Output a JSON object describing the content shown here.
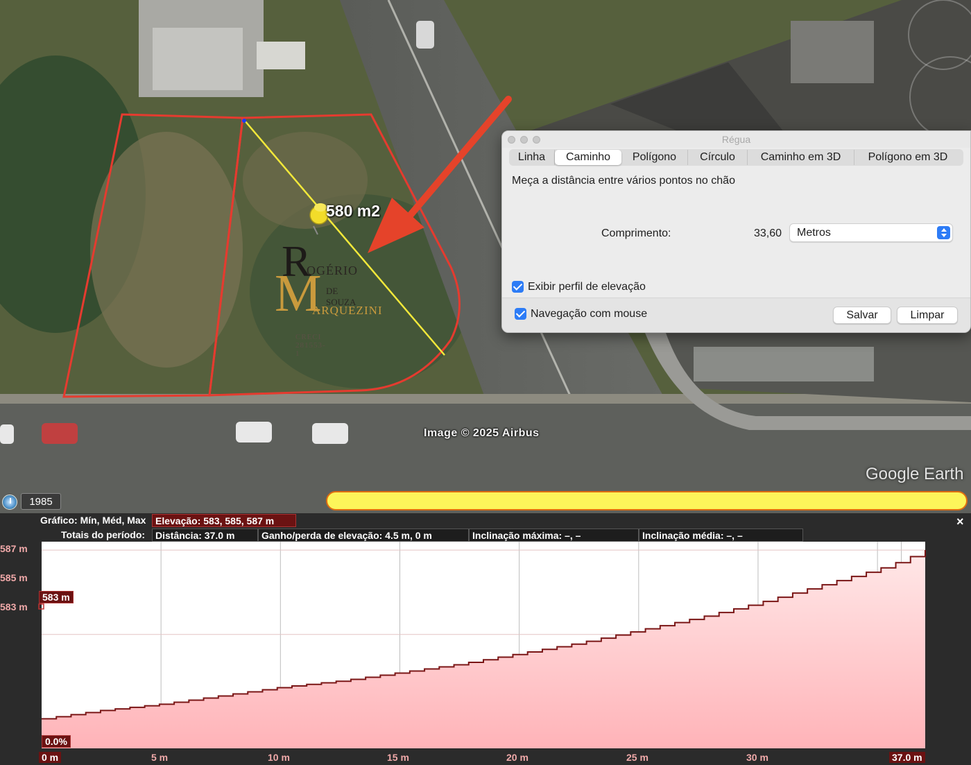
{
  "map": {
    "area_label": "580 m2",
    "attribution": "Image © 2025 Airbus",
    "brand": "Google Earth",
    "year": "1985",
    "watermark": {
      "r": "R",
      "ogerio": "OGÉRIO",
      "desouza": "DE SOUZA",
      "m": "M",
      "arquezini": "ARQUEZINI",
      "creci": "CRECI 281553-1"
    },
    "colors": {
      "parcel_outline": "#e53b2f",
      "measure_line": "#f2e83a",
      "arrow": "#e5432a",
      "timeline": "#fdf55a"
    },
    "icons": {
      "pin": "pushpin-icon",
      "clock": "historical-imagery-icon"
    }
  },
  "ruler": {
    "title": "Régua",
    "tabs": [
      "Linha",
      "Caminho",
      "Polígono",
      "Círculo",
      "Caminho em 3D",
      "Polígono em 3D"
    ],
    "active_tab": "Caminho",
    "description": "Meça a distância entre vários pontos no chão",
    "length_label": "Comprimento:",
    "length_value": "33,60",
    "unit": "Metros",
    "show_elevation_label": "Exibir perfil de elevação",
    "mouse_nav_label": "Navegação com mouse",
    "save_label": "Salvar",
    "clear_label": "Limpar",
    "accent": "#2d7cf6"
  },
  "profile": {
    "row1_label": "Gráfico: Mín, Méd, Max",
    "elevation": "Elevação: 583, 585, 587 m",
    "row2_label": "Totais do período:",
    "distance": "Distância: 37.0 m",
    "gain_loss": "Ganho/perda de elevação: 4.5 m, 0 m",
    "max_slope": "Inclinação máxima: –, –",
    "avg_slope": "Inclinação média: –, –",
    "close": "×",
    "y_ticks": [
      "587 m",
      "585 m",
      "583 m"
    ],
    "x_ticks": [
      "0 m",
      "5 m",
      "10 m",
      "15 m",
      "20 m",
      "25 m",
      "30 m",
      "37.0 m"
    ],
    "start_marker": "583 m",
    "slope_marker": "0.0%"
  },
  "chart_data": {
    "type": "line",
    "xlabel": "",
    "ylabel": "",
    "xlim": [
      0,
      37
    ],
    "ylim": [
      582.3,
      587.2
    ],
    "x": [
      0,
      2.5,
      5,
      7.5,
      10,
      12.5,
      15,
      17.5,
      20,
      22.5,
      25,
      27.5,
      30,
      32.5,
      35,
      36,
      37
    ],
    "y": [
      583.0,
      583.2,
      583.35,
      583.55,
      583.75,
      583.9,
      584.1,
      584.3,
      584.55,
      584.8,
      585.1,
      585.4,
      585.75,
      586.15,
      586.55,
      586.75,
      587.0
    ],
    "colors": {
      "line": "#7a1616",
      "fill_top": "#ffe8e8",
      "fill_bottom": "#ffb3b8",
      "grid": "#bdbdbd"
    },
    "grid": true
  }
}
